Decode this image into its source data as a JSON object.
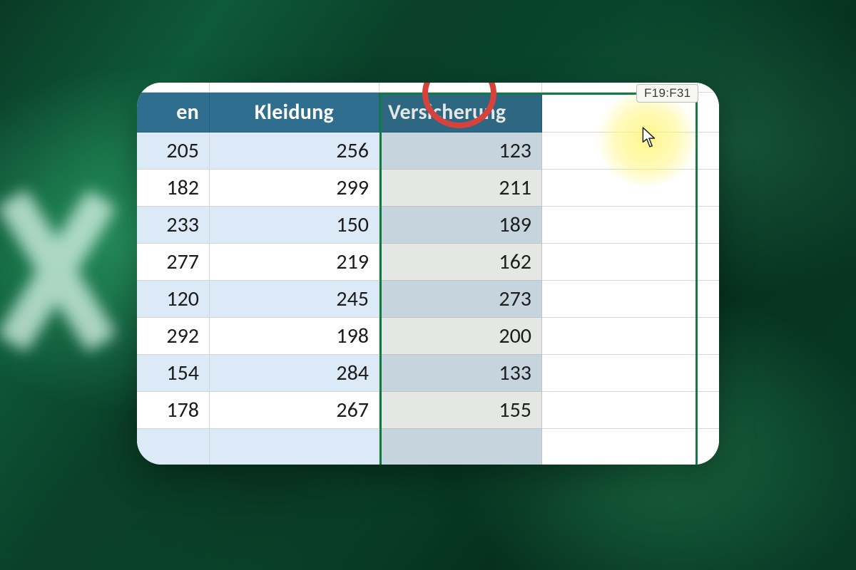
{
  "reference_tooltip": "F19:F31",
  "columns": {
    "a_fragment": "en",
    "b": "Kleidung",
    "c": "Versicherung"
  },
  "rows": [
    {
      "a": "205",
      "b": "256",
      "c": "123"
    },
    {
      "a": "182",
      "b": "299",
      "c": "211"
    },
    {
      "a": "233",
      "b": "150",
      "c": "189"
    },
    {
      "a": "277",
      "b": "219",
      "c": "162"
    },
    {
      "a": "120",
      "b": "245",
      "c": "273"
    },
    {
      "a": "292",
      "b": "198",
      "c": "200"
    },
    {
      "a": "154",
      "b": "284",
      "c": "133"
    },
    {
      "a": "178",
      "b": "267",
      "c": "155"
    }
  ],
  "colors": {
    "header_bg": "#2f6e8f",
    "row_band": "#dbeaf6",
    "selection_border": "#107c41",
    "annotation_ring": "#d8423c",
    "highlight_glow": "#fff578"
  },
  "annotations": {
    "red_ring_target": "column-header-c",
    "cursor_glow": true
  }
}
